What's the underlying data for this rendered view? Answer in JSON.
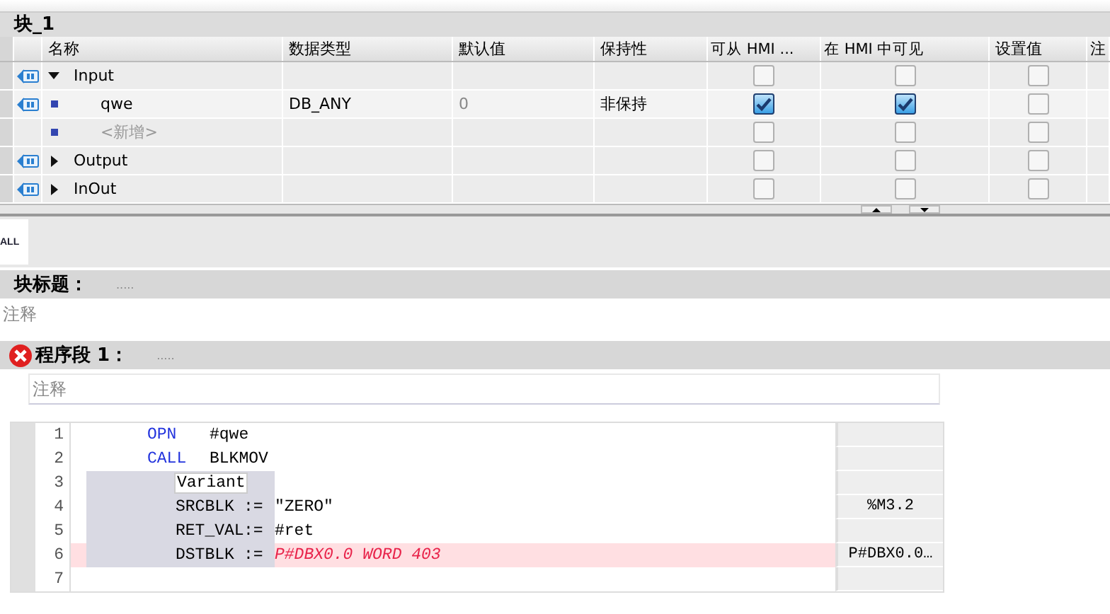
{
  "block_title": "块_1",
  "columns": [
    "名称",
    "数据类型",
    "默认值",
    "保持性",
    "可从 HMI ...",
    "在 HMI 中可见",
    "设置值",
    "注"
  ],
  "rows": [
    {
      "kind": "section",
      "expanded": true,
      "name": "Input",
      "type": "",
      "default": "",
      "retain": "",
      "hmi_access": false,
      "hmi_visible": false,
      "setpoint": false
    },
    {
      "kind": "var",
      "name": "qwe",
      "type": "DB_ANY",
      "default": "0",
      "retain": "非保持",
      "hmi_access": true,
      "hmi_visible": true,
      "setpoint": false
    },
    {
      "kind": "add",
      "name": "<新增>",
      "type": "",
      "default": "",
      "retain": "",
      "hmi_access": false,
      "hmi_visible": false,
      "setpoint": false
    },
    {
      "kind": "section",
      "expanded": false,
      "name": "Output",
      "type": "",
      "default": "",
      "retain": "",
      "hmi_access": false,
      "hmi_visible": false,
      "setpoint": false
    },
    {
      "kind": "section",
      "expanded": false,
      "name": "InOut",
      "type": "",
      "default": "",
      "retain": "",
      "hmi_access": false,
      "hmi_visible": false,
      "setpoint": false
    }
  ],
  "filter_tab": "ALL",
  "block_header": {
    "label": "块标题：",
    "title": ".....",
    "comment": "注释"
  },
  "network": {
    "label": "程序段 1：",
    "title": ".....",
    "error": true,
    "comment": "注释",
    "lines": [
      {
        "number": "1",
        "kind": "instr",
        "op": "OPN",
        "arg": "#qwe",
        "error": false
      },
      {
        "number": "2",
        "kind": "instr",
        "op": "CALL",
        "arg": "BLKMOV",
        "error": false
      },
      {
        "number": "3",
        "kind": "type",
        "name": "Variant",
        "error": false
      },
      {
        "number": "4",
        "kind": "param",
        "name": "SRCBLK",
        "assign": ":=",
        "value": "\"ZERO\"",
        "error": false,
        "operand": "%M3.2"
      },
      {
        "number": "5",
        "kind": "param",
        "name": "RET_VAL",
        "assign": ":=",
        "value": "#ret",
        "error": false
      },
      {
        "number": "6",
        "kind": "param",
        "name": "DSTBLK",
        "assign": ":=",
        "value": "P#DBX0.0 WORD 403",
        "error": true,
        "operand": "P#DBX0.0…"
      },
      {
        "number": "7",
        "kind": "empty",
        "error": false
      }
    ]
  }
}
